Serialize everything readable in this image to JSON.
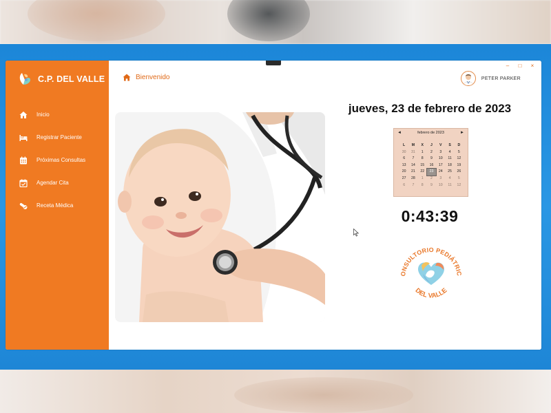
{
  "app": {
    "title": "C.P. DEL VALLE",
    "accent_color": "#f07a22"
  },
  "sidebar": {
    "items": [
      {
        "label": "Inicio",
        "icon": "home-icon"
      },
      {
        "label": "Registrar Paciente",
        "icon": "bed-icon"
      },
      {
        "label": "Próximas Consultas",
        "icon": "calendar-icon"
      },
      {
        "label": "Agendar Cita",
        "icon": "calendar-check-icon"
      },
      {
        "label": "Receta Médica",
        "icon": "pills-icon"
      }
    ]
  },
  "header": {
    "breadcrumb": "Bienvenido",
    "user_name": "PETER PARKER",
    "window_controls": [
      "–",
      "□",
      "×"
    ]
  },
  "main": {
    "date_text": "jueves, 23 de febrero de 2023",
    "clock_text": "0:43:39"
  },
  "calendar": {
    "month_label": "febrero de 2023",
    "prev": "◄",
    "next": "►",
    "weekdays": [
      "L",
      "M",
      "X",
      "J",
      "V",
      "S",
      "D"
    ],
    "weeks": [
      [
        "30",
        "31",
        "1",
        "2",
        "3",
        "4",
        "5"
      ],
      [
        "6",
        "7",
        "8",
        "9",
        "10",
        "11",
        "12"
      ],
      [
        "13",
        "14",
        "15",
        "16",
        "17",
        "18",
        "19"
      ],
      [
        "20",
        "21",
        "22",
        "23",
        "24",
        "25",
        "26"
      ],
      [
        "27",
        "28",
        "1",
        "2",
        "3",
        "4",
        "5"
      ],
      [
        "6",
        "7",
        "8",
        "9",
        "10",
        "11",
        "12"
      ]
    ],
    "selected_day": "23"
  },
  "logo_badge": {
    "top_text": "CONSULTORIO PEDIÁTRICO",
    "bottom_text": "DEL VALLE"
  }
}
